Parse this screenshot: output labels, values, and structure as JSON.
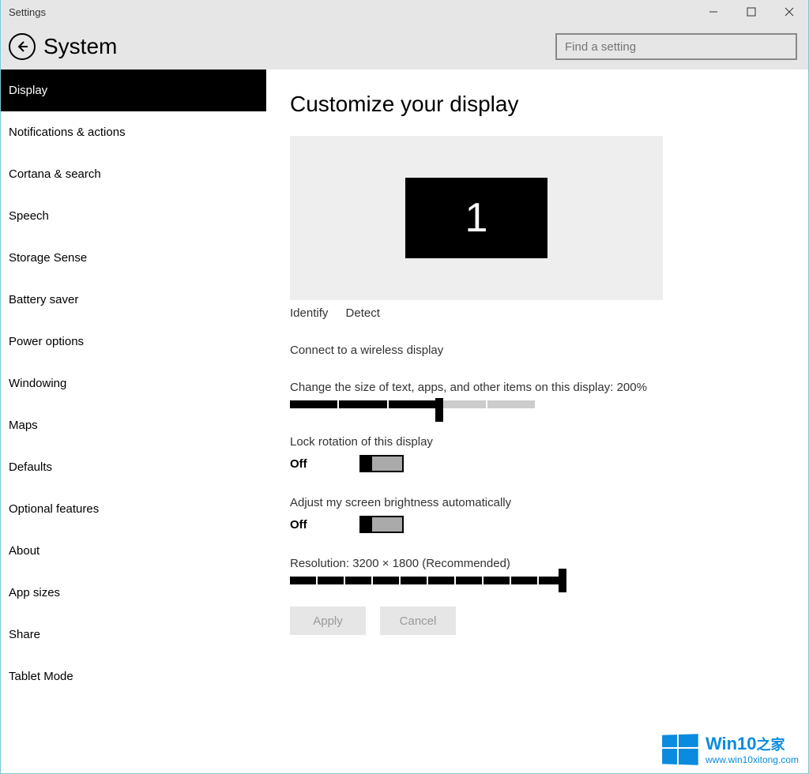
{
  "window": {
    "title": "Settings"
  },
  "header": {
    "title": "System",
    "search_placeholder": "Find a setting"
  },
  "sidebar": {
    "items": [
      {
        "label": "Display",
        "active": true
      },
      {
        "label": "Notifications & actions"
      },
      {
        "label": "Cortana & search"
      },
      {
        "label": "Speech"
      },
      {
        "label": "Storage Sense"
      },
      {
        "label": "Battery saver"
      },
      {
        "label": "Power options"
      },
      {
        "label": "Windowing"
      },
      {
        "label": "Maps"
      },
      {
        "label": "Defaults"
      },
      {
        "label": "Optional features"
      },
      {
        "label": "About"
      },
      {
        "label": "App sizes"
      },
      {
        "label": "Share"
      },
      {
        "label": "Tablet Mode"
      }
    ]
  },
  "main": {
    "page_title": "Customize your display",
    "monitor_number": "1",
    "identify_label": "Identify",
    "detect_label": "Detect",
    "connect_wireless": "Connect to a wireless display",
    "scale_label": "Change the size of text, apps, and other items on this display: 200%",
    "scale_slider": {
      "segments": 5,
      "filled": 3
    },
    "lock_rotation_label": "Lock rotation of this display",
    "lock_rotation_value": "Off",
    "brightness_label": "Adjust my screen brightness automatically",
    "brightness_value": "Off",
    "resolution_label": "Resolution: 3200 × 1800 (Recommended)",
    "resolution_slider": {
      "segments": 10,
      "filled": 10
    },
    "apply_label": "Apply",
    "cancel_label": "Cancel"
  },
  "watermark": {
    "line1_a": "Win10",
    "line1_b": "之家",
    "line2": "www.win10xitong.com"
  }
}
